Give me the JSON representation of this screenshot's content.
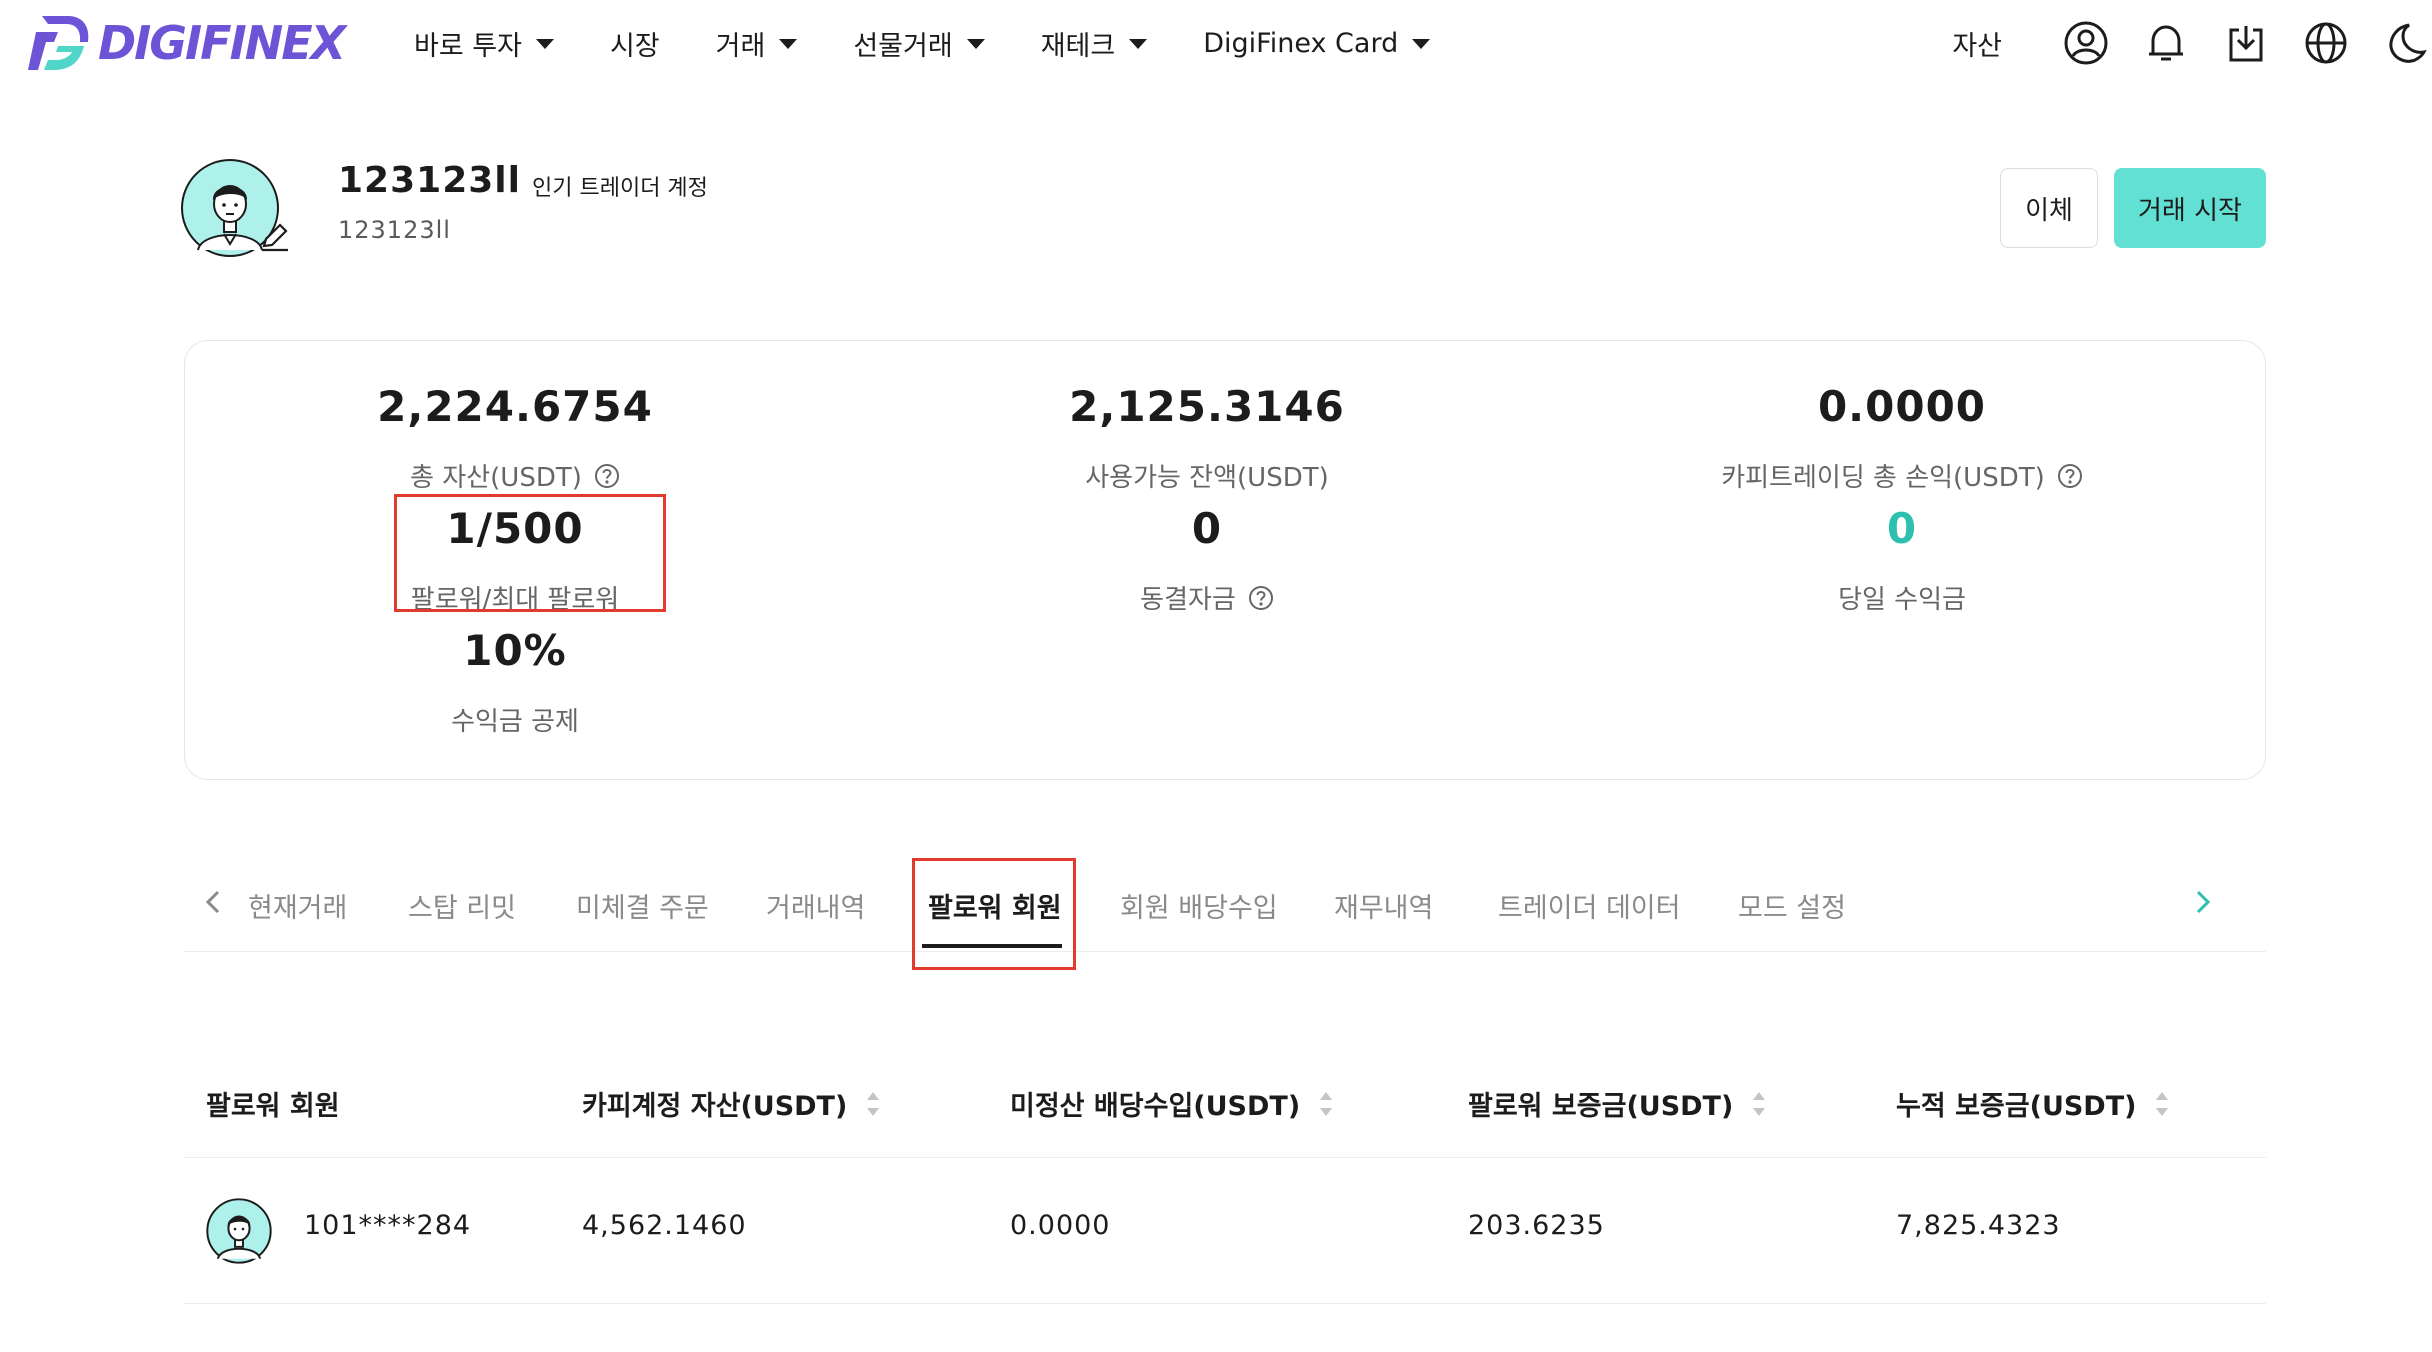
{
  "brand": {
    "name": "DIGIFINEX",
    "accent": "#6d54d6",
    "teal": "#63e0d4"
  },
  "nav": {
    "items": [
      {
        "label": "바로 투자",
        "dropdown": true
      },
      {
        "label": "시장",
        "dropdown": false
      },
      {
        "label": "거래",
        "dropdown": true
      },
      {
        "label": "선물거래",
        "dropdown": true
      },
      {
        "label": "재테크",
        "dropdown": true
      },
      {
        "label": "DigiFinex Card",
        "dropdown": true
      }
    ],
    "asset_label": "자산",
    "icons": [
      "user-icon",
      "bell-icon",
      "download-icon",
      "globe-icon",
      "moon-icon"
    ]
  },
  "profile": {
    "name": "123123ll",
    "badge": "인기 트레이더 계정",
    "sub": "123123ll",
    "transfer_label": "이체",
    "start_label": "거래 시작"
  },
  "stats": {
    "total_assets": {
      "value": "2,224.6754",
      "label": "총 자산(USDT)"
    },
    "available": {
      "value": "2,125.3146",
      "label": "사용가능 잔액(USDT)"
    },
    "copy_pnl": {
      "value": "0.0000",
      "label": "카피트레이딩 총 손익(USDT)"
    },
    "followers": {
      "value": "1/500",
      "label": "팔로워/최대 팔로워"
    },
    "frozen": {
      "value": "0",
      "label": "동결자금"
    },
    "today_income": {
      "value": "0",
      "label": "당일 수익금"
    },
    "profit_share": {
      "value": "10%",
      "label": "수익금 공제"
    }
  },
  "tabs": {
    "items": [
      "현재거래",
      "스탑 리밋",
      "미체결 주문",
      "거래내역",
      "팔로워 회원",
      "회원 배당수입",
      "재무내역",
      "트레이더 데이터",
      "모드 설정"
    ],
    "active_index": 4
  },
  "table": {
    "headers": [
      "팔로워 회원",
      "카피계정 자산(USDT)",
      "미정산 배당수입(USDT)",
      "팔로워 보증금(USDT)",
      "누적 보증금(USDT)"
    ],
    "rows": [
      {
        "member": "101****284",
        "copy_assets": "4,562.1460",
        "unsettled": "0.0000",
        "deposit": "203.6235",
        "cumulative": "7,825.4323"
      }
    ]
  }
}
